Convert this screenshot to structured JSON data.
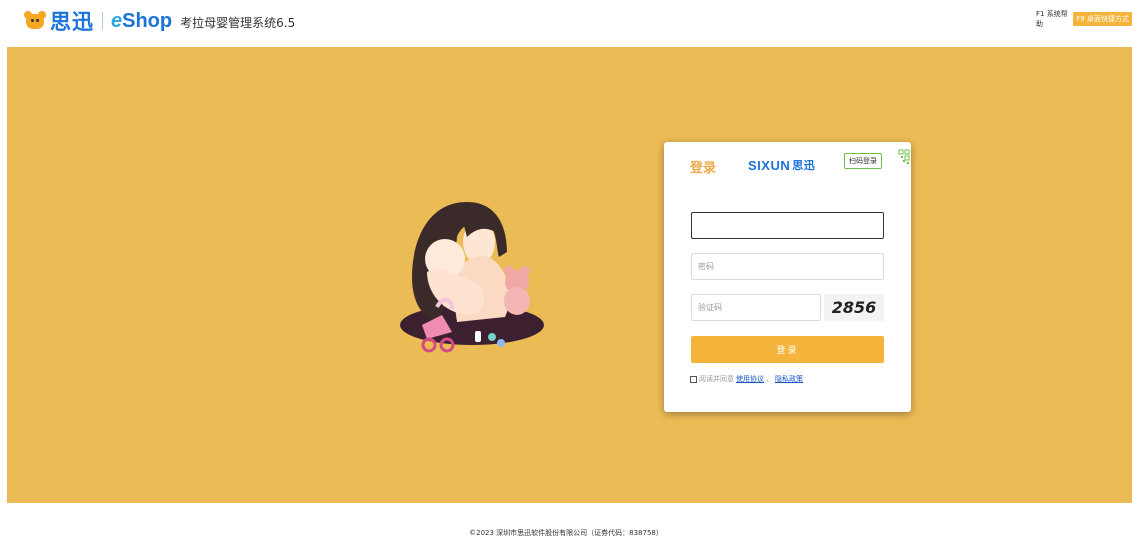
{
  "header": {
    "brand_cn": "思迅",
    "brand_eshop_e": "e",
    "brand_eshop_rest": "Shop",
    "product_title": "考拉母婴管理系统6.5",
    "help_label": "F1 系统帮助",
    "shortcut_label": "F9 桌面快捷方式"
  },
  "login": {
    "tab_label": "登录",
    "brand_en": "SIXUN",
    "brand_cn": "思迅",
    "qr_tip": "扫码登录",
    "username_placeholder": "",
    "password_placeholder": "密码",
    "captcha_placeholder": "验证码",
    "captcha_code": "2856",
    "submit_label": "登录",
    "agree_prefix": "阅读并同意",
    "terms_link": "使用协议",
    "separator": "、",
    "privacy_link": "隐私政策"
  },
  "footer": {
    "copyright": "©2023 深圳市思迅软件股份有限公司（证券代码：838758）"
  },
  "colors": {
    "banner": "#ebbc55",
    "brand_blue": "#1a73d9",
    "button": "#f5b43c",
    "tab_active": "#eea94a"
  }
}
